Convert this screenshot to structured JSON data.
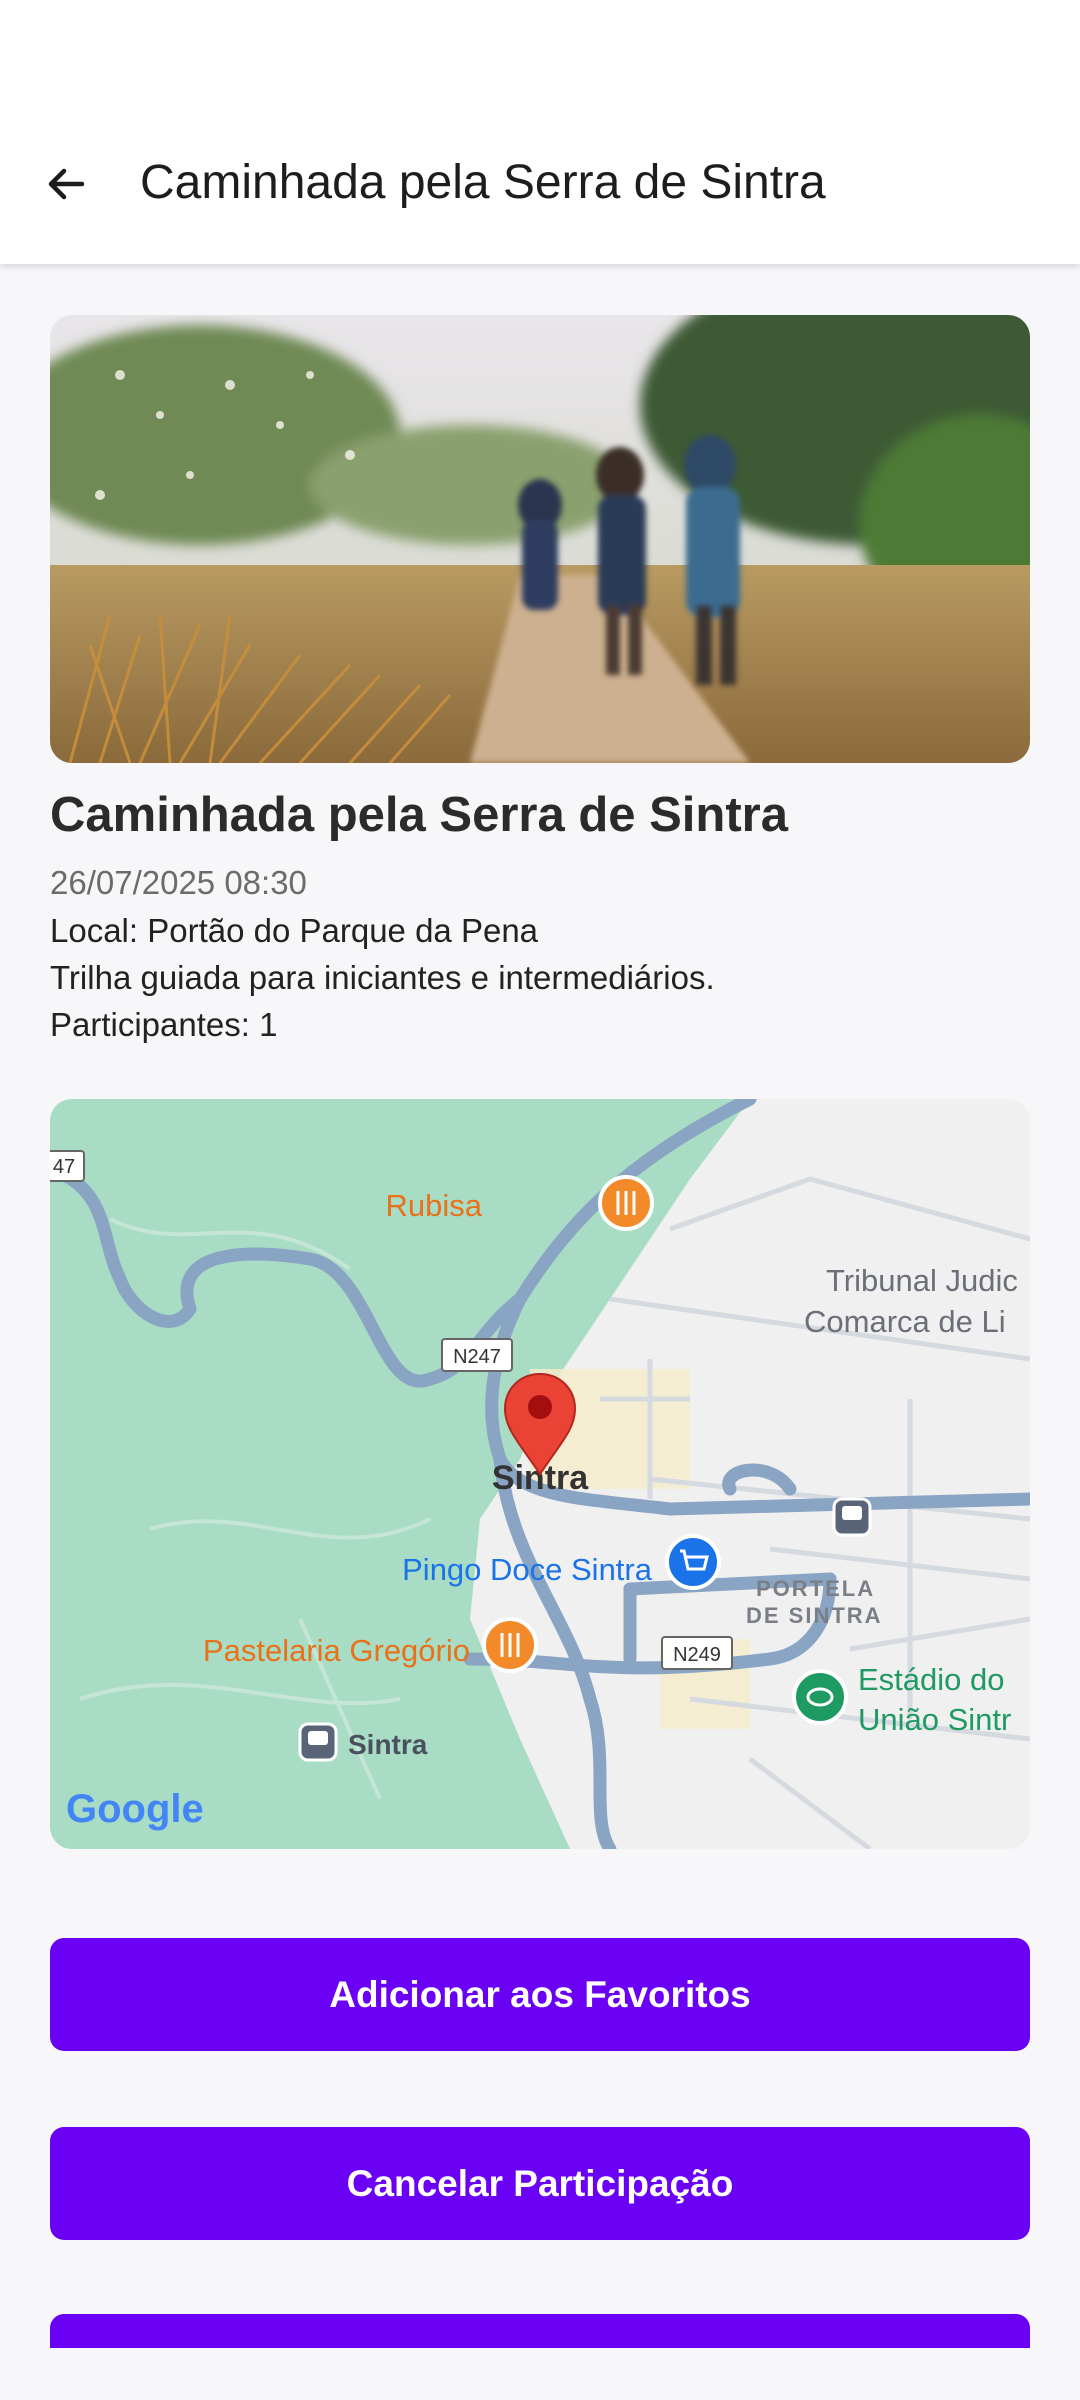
{
  "header": {
    "title": "Caminhada pela Serra de Sintra",
    "back_icon": "arrow-back-icon"
  },
  "event": {
    "title": "Caminhada pela Serra de Sintra",
    "datetime": "26/07/2025 08:30",
    "location": "Local: Portão do Parque da Pena",
    "description": "Trilha guiada para iniciantes e intermediários.",
    "participants": "Participantes: 1"
  },
  "map": {
    "labels": {
      "rubisa": "Rubisa",
      "tribunal_1": "Tribunal Judic",
      "tribunal_2": "Comarca de Li",
      "n247": "N247",
      "road_47": "47",
      "sintra_center": "Sintra",
      "pingo_doce": "Pingo Doce Sintra",
      "portela_1": "PORTELA",
      "portela_2": "DE SINTRA",
      "pastelaria": "Pastelaria Gregório",
      "n249": "N249",
      "estadio_1": "Estádio do",
      "estadio_2": "União Sintr",
      "station": "Sintra",
      "google": "Google"
    },
    "colors": {
      "park": "#a8dcc5",
      "road": "#8aa4c4",
      "food": "#e8711a",
      "shop": "#1a73e8",
      "sport": "#1e9a63",
      "pin": "#ea4335"
    }
  },
  "actions": {
    "favorite_label": "Adicionar aos Favoritos",
    "cancel_label": "Cancelar Participação"
  },
  "theme": {
    "primary": "#6a00f4"
  }
}
